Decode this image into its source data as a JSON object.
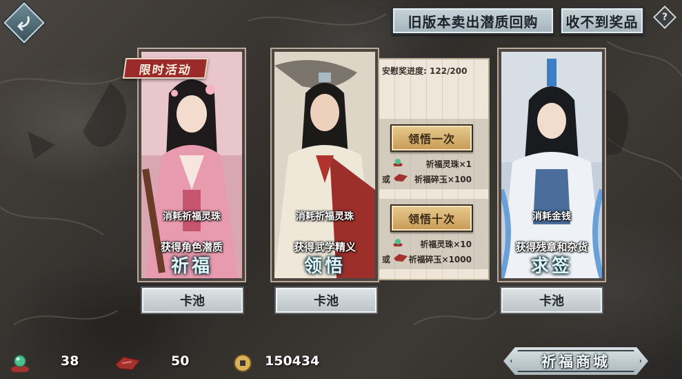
{
  "header": {
    "buyback_button_label": "旧版本卖出潜质回购",
    "no_reward_button_label": "收不到奖品",
    "help_label": "?"
  },
  "cards": [
    {
      "id": "blessing",
      "badge": "限时活动",
      "cost_text": "消耗祈福灵珠",
      "gain_text": "获得角色潜质",
      "title": "祈福",
      "pool_button_label": "卡池"
    },
    {
      "id": "comprehend",
      "cost_text": "消耗祈福灵珠",
      "gain_text": "获得武学精义",
      "title": "领悟",
      "pool_button_label": "卡池"
    },
    {
      "id": "divination",
      "cost_text": "消耗金钱",
      "gain_text": "获得残章和杂货",
      "title": "求签",
      "pool_button_label": "卡池"
    }
  ],
  "draw_panel": {
    "progress_label": "安慰奖进度:",
    "progress_value": "122/200",
    "once": {
      "button_label": "领悟一次",
      "cost_primary": "祈福灵珠×1",
      "or_label": "或",
      "cost_alt": "祈福碎玉×100"
    },
    "ten": {
      "button_label": "领悟十次",
      "cost_primary": "祈福灵珠×10",
      "or_label": "或",
      "cost_alt": "祈福碎玉×1000"
    }
  },
  "resources": {
    "orb_count": "38",
    "jade_count": "50",
    "coin_count": "150434"
  },
  "shop_button_label": "祈福商城",
  "icons": [
    "back-arrow-icon",
    "help-icon",
    "orb-icon",
    "jade-shard-icon",
    "coin-icon"
  ]
}
